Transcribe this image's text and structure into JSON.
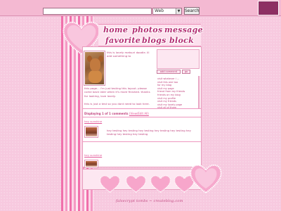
{
  "search": {
    "value": "",
    "select_value": "Web",
    "button_label": "Search"
  },
  "nav": {
    "home": "home",
    "photos": "photos",
    "message": "message",
    "favorite": "favorite",
    "blogs": "blogs",
    "block": "block"
  },
  "about": {
    "line1": "this is lovely matsuri doodle. ill add something to",
    "wide": "this page... i'm just testing this layout. please come back later when it's more finished. thanks for looking, love lovely.",
    "last": "this is just a test so you dont need to look here."
  },
  "sidebar": {
    "input_label": "add comment",
    "button_label": "go",
    "links": [
      "visit whatever i ...",
      "visit this one too",
      "for my blog",
      "visit my page",
      "friend from my friends",
      "friends on my blog",
      "visit my profile",
      "visit my friends",
      "visit my lovely page",
      "visit all of them",
      "visit this one",
      "visit my blog"
    ]
  },
  "comments": {
    "header": "Displaying 1 of 1 comments",
    "header_link": "(View/Edit All)",
    "items": [
      {
        "author": "hey sunshine",
        "body": "hey testing hey testing hey testing hey testing hey testing hey testing hey testing hey testing"
      },
      {
        "author": "hey sunshine",
        "body": ""
      }
    ]
  },
  "footer": {
    "credit": "falsecrypt tombs ~ createblog.com"
  },
  "colors": {
    "page_background": "#f7c9df",
    "accent_pink": "#f06aa8",
    "nav_text": "#b32f73",
    "body_text": "#c0447e",
    "link_pink": "#e25596"
  }
}
